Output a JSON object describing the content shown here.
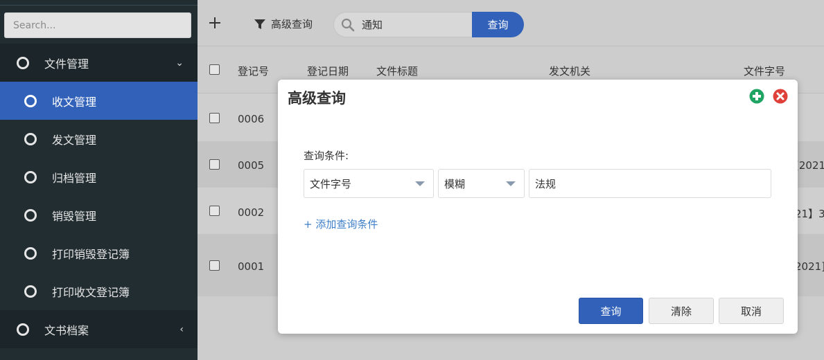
{
  "sidebar": {
    "search_placeholder": "Search...",
    "items": [
      {
        "label": "文件管理",
        "caret": "⌄"
      },
      {
        "label": "收文管理"
      },
      {
        "label": "发文管理"
      },
      {
        "label": "归档管理"
      },
      {
        "label": "销毁管理"
      },
      {
        "label": "打印销毁登记簿"
      },
      {
        "label": "打印收文登记簿"
      },
      {
        "label": "文书档案",
        "caret": "‹"
      }
    ]
  },
  "toolbar": {
    "advanced_label": "高级查询",
    "search_value": "通知",
    "search_button": "查询"
  },
  "table": {
    "headers": [
      "登记号",
      "登记日期",
      "文件标题",
      "发文机关",
      "文件字号"
    ],
    "rows": [
      {
        "id": "0006",
        "tail": ""
      },
      {
        "id": "0005",
        "tail": "[2021]"
      },
      {
        "id": "0002",
        "tail": "21】3"
      },
      {
        "id": "0001",
        "tail": "2021]"
      }
    ]
  },
  "dialog": {
    "title": "高级查询",
    "condition_label": "查询条件:",
    "field_select": "文件字号",
    "match_select": "模糊",
    "value": "法规",
    "add_condition": "+ 添加查询条件",
    "buttons": {
      "query": "查询",
      "clear": "清除",
      "cancel": "取消"
    },
    "icons": {
      "add": "plus-circle-icon",
      "close": "close-circle-icon"
    },
    "colors": {
      "add": "#1fa463",
      "close": "#e0403a"
    }
  }
}
